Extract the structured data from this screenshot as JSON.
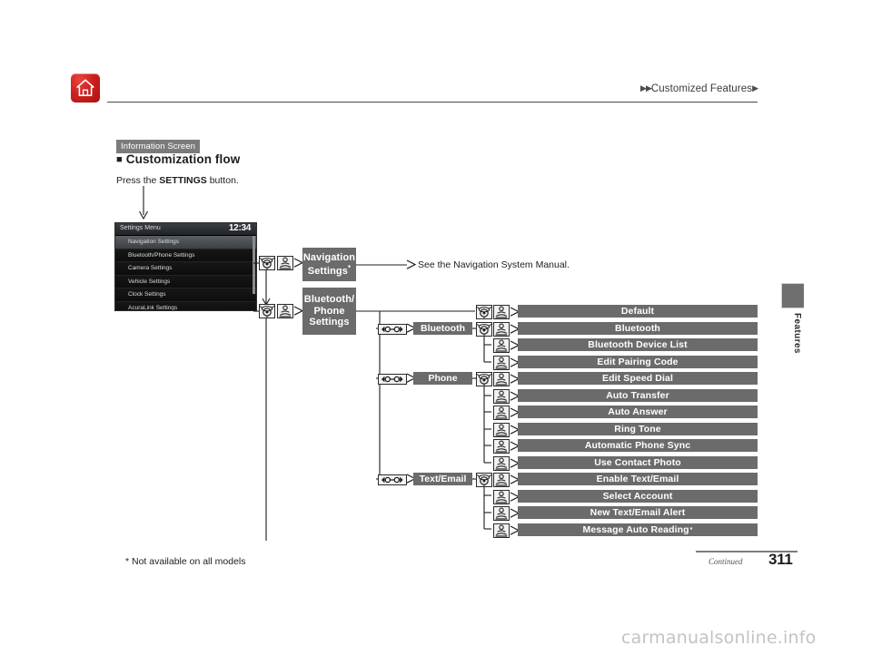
{
  "header": {
    "home_icon": "home-icon",
    "breadcrumb_prefix": "▶▶",
    "breadcrumb_title": "Customized Features",
    "breadcrumb_suffix": "▶",
    "side_tab_label": "Features"
  },
  "intro": {
    "chip": "Information Screen",
    "square": "■",
    "section_title": "Customization flow",
    "instruction_pre": "Press the ",
    "instruction_bold": "SETTINGS",
    "instruction_post": " button."
  },
  "head_unit": {
    "title": "Settings Menu",
    "clock": "12:34",
    "rows": [
      {
        "label": "Navigation Settings",
        "selected": true
      },
      {
        "label": "Bluetooth/Phone Settings",
        "selected": false
      },
      {
        "label": "Camera Settings",
        "selected": false
      },
      {
        "label": "Vehicle Settings",
        "selected": false
      },
      {
        "label": "Clock Settings",
        "selected": false
      },
      {
        "label": "AcuraLink Settings",
        "selected": false
      }
    ]
  },
  "flow": {
    "icons": {
      "knob": "rotary-knob-icon",
      "enter": "enter-knob-icon",
      "lr": "left-right-selector-icon",
      "arrow": "arrow-right-icon"
    },
    "branch_nodes": [
      {
        "id": "navigation-settings",
        "lines": [
          "Navigation",
          "Settings"
        ],
        "asterisk": true
      },
      {
        "id": "bluetooth-phone-settings",
        "lines": [
          "Bluetooth/",
          "Phone",
          "Settings"
        ],
        "asterisk": false
      }
    ],
    "navigation_note": "See the Navigation System Manual.",
    "categories": [
      {
        "id": "bluetooth",
        "label": "Bluetooth"
      },
      {
        "id": "phone",
        "label": "Phone"
      },
      {
        "id": "text-email",
        "label": "Text/Email"
      }
    ],
    "items": [
      {
        "label": "Default",
        "asterisk": false
      },
      {
        "label": "Bluetooth",
        "asterisk": false
      },
      {
        "label": "Bluetooth Device List",
        "asterisk": false
      },
      {
        "label": "Edit Pairing Code",
        "asterisk": false
      },
      {
        "label": "Edit Speed Dial",
        "asterisk": false
      },
      {
        "label": "Auto Transfer",
        "asterisk": false
      },
      {
        "label": "Auto Answer",
        "asterisk": false
      },
      {
        "label": "Ring Tone",
        "asterisk": false
      },
      {
        "label": "Automatic Phone Sync",
        "asterisk": false
      },
      {
        "label": "Use Contact Photo",
        "asterisk": false
      },
      {
        "label": "Enable Text/Email",
        "asterisk": false
      },
      {
        "label": "Select Account",
        "asterisk": false
      },
      {
        "label": "New Text/Email Alert",
        "asterisk": false
      },
      {
        "label": "Message Auto Reading",
        "asterisk": true
      }
    ]
  },
  "footer": {
    "note": "* Not available on all models",
    "continued": "Continued",
    "page_number": "311",
    "watermark": "carmanualsonline.info"
  },
  "colors": {
    "node_gray": "#6b6b6b",
    "home_red": "#cf2020",
    "text_dark": "#1d1d1d"
  }
}
